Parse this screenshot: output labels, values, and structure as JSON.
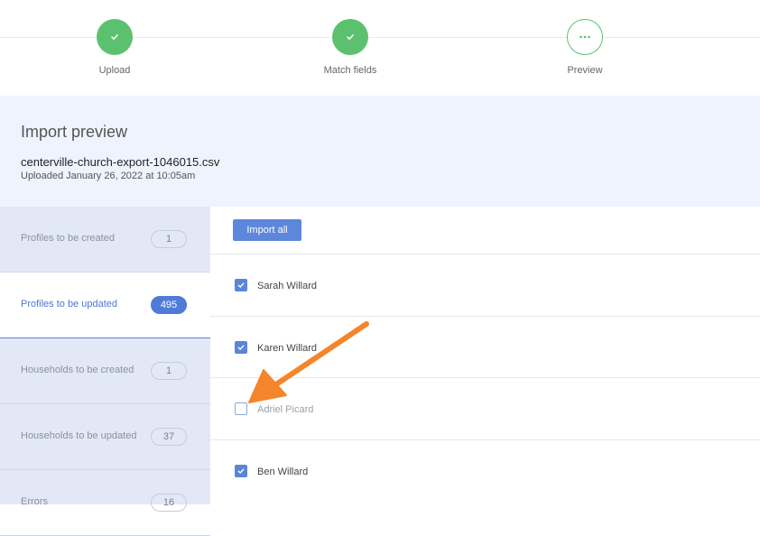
{
  "stepper": {
    "steps": [
      {
        "label": "Upload",
        "state": "done"
      },
      {
        "label": "Match fields",
        "state": "done"
      },
      {
        "label": "Preview",
        "state": "current"
      }
    ]
  },
  "header": {
    "title": "Import preview",
    "file_name": "centerville-church-export-1046015.csv",
    "uploaded": "Uploaded January 26, 2022 at 10:05am"
  },
  "sidebar": {
    "items": [
      {
        "label": "Profiles to be created",
        "count": "1",
        "active": false
      },
      {
        "label": "Profiles to be updated",
        "count": "495",
        "active": true
      },
      {
        "label": "Households to be created",
        "count": "1",
        "active": false
      },
      {
        "label": "Households to be updated",
        "count": "37",
        "active": false
      },
      {
        "label": "Errors",
        "count": "16",
        "active": false
      }
    ]
  },
  "main": {
    "import_all_label": "Import all",
    "rows": [
      {
        "name": "Sarah Willard",
        "checked": true
      },
      {
        "name": "Karen Willard",
        "checked": true
      },
      {
        "name": "Adriel Picard",
        "checked": false
      },
      {
        "name": "Ben Willard",
        "checked": true
      }
    ]
  },
  "colors": {
    "success": "#5cc16e",
    "primary": "#5c87da",
    "annotation_arrow": "#f5852a",
    "header_bg": "#eef3fd",
    "sidebar_bg": "#e3e8f6"
  },
  "icons": {
    "step_done": "check-icon",
    "step_current": "ellipsis-icon",
    "row_checked": "checkbox-checked-icon"
  }
}
